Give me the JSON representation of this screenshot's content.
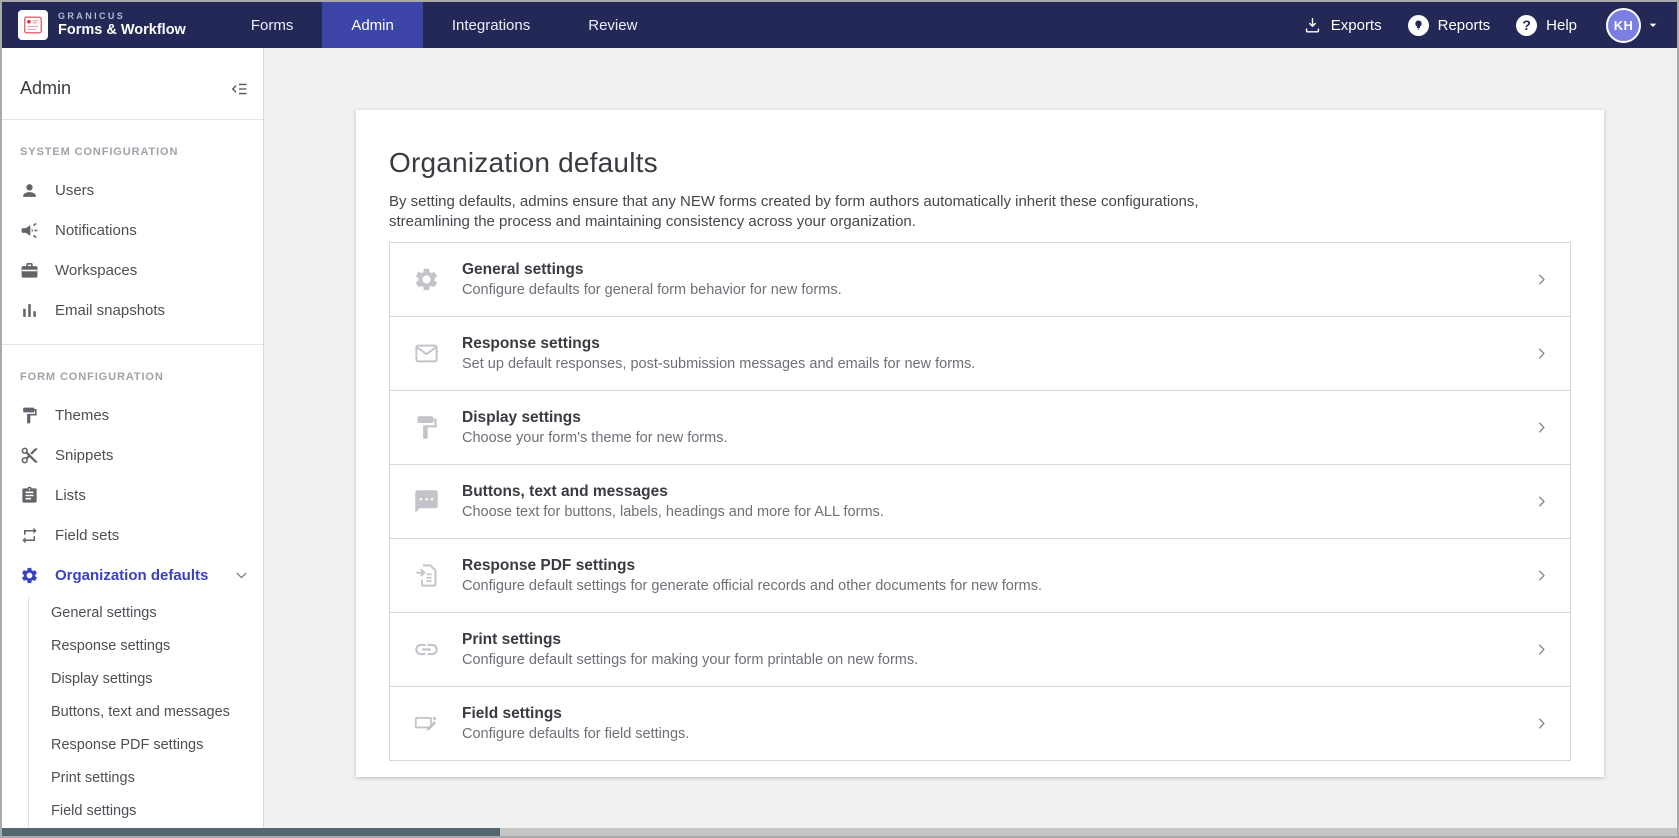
{
  "colors": {
    "topbar_bg": "#232856",
    "active_tab": "#3e45a8",
    "accent": "#3a41c6",
    "avatar_bg": "#7b7fe1"
  },
  "topbar": {
    "brand": {
      "name": "GRANICUS",
      "product": "Forms & Workflow"
    },
    "nav": [
      {
        "label": "Forms",
        "active": false
      },
      {
        "label": "Admin",
        "active": true
      },
      {
        "label": "Integrations",
        "active": false
      },
      {
        "label": "Review",
        "active": false
      }
    ],
    "actions": [
      {
        "label": "Exports",
        "icon": "download-icon"
      },
      {
        "label": "Reports",
        "icon": "lightbulb-icon"
      },
      {
        "label": "Help",
        "icon": "help-icon"
      }
    ],
    "avatar": {
      "initials": "KH"
    }
  },
  "sidebar": {
    "title": "Admin",
    "sections": [
      {
        "label": "SYSTEM CONFIGURATION",
        "items": [
          {
            "label": "Users",
            "icon": "user-icon"
          },
          {
            "label": "Notifications",
            "icon": "megaphone-icon"
          },
          {
            "label": "Workspaces",
            "icon": "briefcase-icon"
          },
          {
            "label": "Email snapshots",
            "icon": "bar-chart-icon"
          }
        ]
      },
      {
        "label": "FORM CONFIGURATION",
        "items": [
          {
            "label": "Themes",
            "icon": "paint-roller-icon"
          },
          {
            "label": "Snippets",
            "icon": "scissors-icon"
          },
          {
            "label": "Lists",
            "icon": "clipboard-icon"
          },
          {
            "label": "Field sets",
            "icon": "repeat-icon"
          },
          {
            "label": "Organization defaults",
            "icon": "gear-icon",
            "active": true,
            "expanded": true
          }
        ]
      }
    ],
    "subitems": [
      "General settings",
      "Response settings",
      "Display settings",
      "Buttons, text and messages",
      "Response PDF settings",
      "Print settings",
      "Field settings"
    ]
  },
  "main": {
    "title": "Organization defaults",
    "description_lines": [
      "By setting defaults, admins ensure that any NEW forms created by form authors automatically inherit these configurations,",
      "streamlining the process and maintaining consistency across your organization."
    ],
    "settings": [
      {
        "title": "General settings",
        "description": "Configure defaults for general form behavior for new forms.",
        "icon": "gear-icon"
      },
      {
        "title": "Response settings",
        "description": "Set up default responses, post-submission messages and emails for new forms.",
        "icon": "mail-icon"
      },
      {
        "title": "Display settings",
        "description": "Choose your form's theme for new forms.",
        "icon": "paint-roller-icon"
      },
      {
        "title": "Buttons, text and messages",
        "description": "Choose text for buttons, labels, headings and more for ALL forms.",
        "icon": "chat-icon"
      },
      {
        "title": "Response PDF settings",
        "description": "Configure default settings for generate official records and other documents for new forms.",
        "icon": "document-icon"
      },
      {
        "title": "Print settings",
        "description": "Configure default settings for making your form printable on new forms.",
        "icon": "link-icon"
      },
      {
        "title": "Field settings",
        "description": "Configure defaults for field settings.",
        "icon": "field-edit-icon"
      }
    ]
  }
}
